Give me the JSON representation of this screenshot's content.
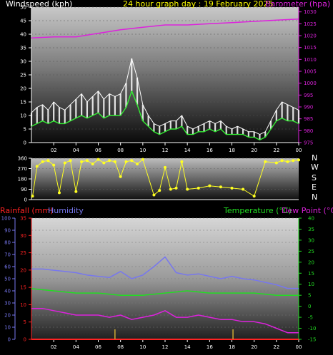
{
  "header": {
    "windspeed_label": "Windspeed (kph)",
    "title": "24 hour graph day : 19 February 2025",
    "barometer_label": "Barometer (hpa)"
  },
  "bottom_header": {
    "rainfall_label": "Rainfall (mm)",
    "humidity_label": "Humidity",
    "temperature_label": "Temperature (°C)",
    "dewpoint_label": "Dew Point (°C)"
  },
  "compass": [
    "N",
    "W",
    "S",
    "E",
    "N"
  ],
  "colors": {
    "wind": "#ffffff",
    "wind_avg": "#33ee33",
    "barometer": "#dd22dd",
    "direction": "#ffff22",
    "rainfall": "#ff2222",
    "humidity": "#7777ee",
    "temperature": "#22dd22",
    "dewpoint": "#dd22dd",
    "title": "#ffff00"
  },
  "chart_data": [
    {
      "type": "line",
      "x_ticks": [
        "02",
        "04",
        "06",
        "08",
        "10",
        "12",
        "14",
        "16",
        "18",
        "20",
        "22",
        "00"
      ],
      "y_left": {
        "label": "Windspeed (kph)",
        "lim": [
          0,
          50
        ],
        "ticks": [
          "0",
          "5",
          "10",
          "15",
          "20",
          "25",
          "30",
          "35",
          "40",
          "45",
          "50"
        ]
      },
      "y_right": {
        "label": "Barometer (hpa)",
        "lim": [
          975,
          1032
        ],
        "ticks": [
          "975",
          "980",
          "985",
          "990",
          "995",
          "1000",
          "1005",
          "1010",
          "1015",
          "1020",
          "1025",
          "1030"
        ]
      },
      "series": [
        {
          "name": "gust",
          "x": [
            0,
            0.5,
            1,
            1.5,
            2,
            2.5,
            3,
            3.5,
            4,
            4.5,
            5,
            5.5,
            6,
            6.5,
            7,
            7.5,
            8,
            8.5,
            9,
            9.5,
            10,
            10.5,
            11,
            11.5,
            12,
            12.5,
            13,
            13.5,
            14,
            14.5,
            15,
            15.5,
            16,
            16.5,
            17,
            17.5,
            18,
            18.5,
            19,
            19.5,
            20,
            20.5,
            21,
            21.5,
            22,
            22.5,
            23,
            23.5,
            24
          ],
          "values": [
            11,
            13,
            14,
            12,
            15,
            13,
            12,
            14,
            16,
            18,
            15,
            17,
            19,
            16,
            18,
            17,
            18,
            22,
            31,
            24,
            14,
            10,
            7,
            6,
            7,
            8,
            8,
            10,
            6,
            5,
            6,
            7,
            8,
            7,
            8,
            6,
            5,
            6,
            5,
            4,
            4,
            3,
            4,
            8,
            12,
            15,
            14,
            13,
            12
          ]
        },
        {
          "name": "average",
          "x": [
            0,
            0.5,
            1,
            1.5,
            2,
            2.5,
            3,
            3.5,
            4,
            4.5,
            5,
            5.5,
            6,
            6.5,
            7,
            7.5,
            8,
            8.5,
            9,
            9.5,
            10,
            10.5,
            11,
            11.5,
            12,
            12.5,
            13,
            13.5,
            14,
            14.5,
            15,
            15.5,
            16,
            16.5,
            17,
            17.5,
            18,
            18.5,
            19,
            19.5,
            20,
            20.5,
            21,
            21.5,
            22,
            22.5,
            23,
            23.5,
            24
          ],
          "values": [
            6,
            7,
            8,
            7,
            8,
            7,
            7,
            8,
            9,
            10,
            9,
            10,
            11,
            9,
            10,
            10,
            10,
            13,
            19,
            14,
            8,
            6,
            4,
            3,
            4,
            5,
            5,
            6,
            3,
            3,
            4,
            4,
            5,
            4,
            5,
            3,
            3,
            3,
            3,
            2,
            2,
            1,
            2,
            5,
            8,
            9,
            8,
            8,
            7
          ]
        },
        {
          "name": "barometer",
          "axis": "right",
          "x": [
            0,
            2,
            4,
            6,
            8,
            10,
            12,
            14,
            16,
            18,
            20,
            22,
            24
          ],
          "values": [
            1019,
            1019.5,
            1019.5,
            1021,
            1022.5,
            1023.5,
            1024.5,
            1024.5,
            1025,
            1025.5,
            1026,
            1026.5,
            1027
          ]
        }
      ]
    },
    {
      "type": "scatter",
      "y_ticks": [
        "0",
        "90",
        "180",
        "270",
        "360"
      ],
      "ylim": [
        0,
        360
      ],
      "note": "Wind direction (degrees)",
      "x": [
        0.1,
        0.5,
        1,
        1.5,
        2,
        2.5,
        3,
        3.5,
        4,
        4.5,
        5,
        5.5,
        6,
        6.5,
        7,
        7.5,
        8,
        8.5,
        9,
        9.5,
        10,
        11,
        11.5,
        12,
        12.5,
        13,
        13.5,
        14,
        15,
        16,
        17,
        18,
        19,
        20,
        21,
        22,
        22.5,
        23,
        23.5,
        24
      ],
      "values": [
        30,
        290,
        330,
        340,
        300,
        60,
        320,
        340,
        70,
        330,
        340,
        310,
        350,
        320,
        340,
        330,
        200,
        330,
        340,
        310,
        350,
        40,
        80,
        280,
        90,
        100,
        330,
        90,
        100,
        120,
        110,
        100,
        90,
        30,
        330,
        320,
        340,
        330,
        340,
        345
      ]
    },
    {
      "type": "line",
      "x_ticks": [
        "02",
        "04",
        "06",
        "08",
        "10",
        "12",
        "14",
        "16",
        "18",
        "20",
        "22",
        "00"
      ],
      "y_humidity": {
        "label": "Humidity",
        "lim": [
          0,
          100
        ],
        "ticks": [
          "0",
          "10",
          "20",
          "30",
          "40",
          "50",
          "60",
          "70",
          "80",
          "90",
          "100"
        ]
      },
      "y_rain": {
        "label": "Rainfall (mm)",
        "lim": [
          0,
          35
        ],
        "ticks": [
          "0",
          "5",
          "10",
          "15",
          "20",
          "25",
          "30",
          "35"
        ]
      },
      "y_temp": {
        "label": "Temperature (°C)",
        "lim": [
          -15,
          40
        ],
        "ticks": [
          "-15",
          "-10",
          "-5",
          "0",
          "5",
          "10",
          "15",
          "20",
          "25",
          "30",
          "35",
          "40"
        ]
      },
      "series": [
        {
          "name": "Humidity",
          "x": [
            0,
            1,
            2,
            3,
            4,
            5,
            6,
            7,
            8,
            9,
            10,
            11,
            12,
            13,
            14,
            15,
            16,
            17,
            18,
            19,
            20,
            21,
            22,
            23,
            24
          ],
          "values": [
            58,
            58,
            57,
            56,
            55,
            53,
            52,
            51,
            56,
            50,
            53,
            60,
            68,
            55,
            53,
            54,
            52,
            50,
            52,
            50,
            49,
            47,
            45,
            42,
            42
          ]
        },
        {
          "name": "Temperature",
          "x": [
            0,
            2,
            4,
            6,
            8,
            10,
            12,
            14,
            16,
            18,
            20,
            22,
            24
          ],
          "values": [
            8,
            7,
            6,
            6,
            5,
            5,
            6,
            7,
            6,
            6,
            6,
            5,
            5
          ]
        },
        {
          "name": "Dew Point",
          "x": [
            0,
            1,
            2,
            3,
            4,
            5,
            6,
            7,
            8,
            9,
            10,
            11,
            12,
            13,
            14,
            15,
            16,
            17,
            18,
            19,
            20,
            21,
            22,
            23,
            24
          ],
          "values": [
            -1,
            -1,
            -2,
            -3,
            -4,
            -4,
            -4,
            -5,
            -4,
            -6,
            -5,
            -4,
            -2,
            -5,
            -5,
            -4,
            -5,
            -6,
            -6,
            -7,
            -7,
            -8,
            -10,
            -12,
            -12
          ]
        },
        {
          "name": "Rainfall",
          "axis": "rain",
          "x": [
            0,
            24
          ],
          "values": [
            0,
            0
          ]
        }
      ]
    }
  ]
}
